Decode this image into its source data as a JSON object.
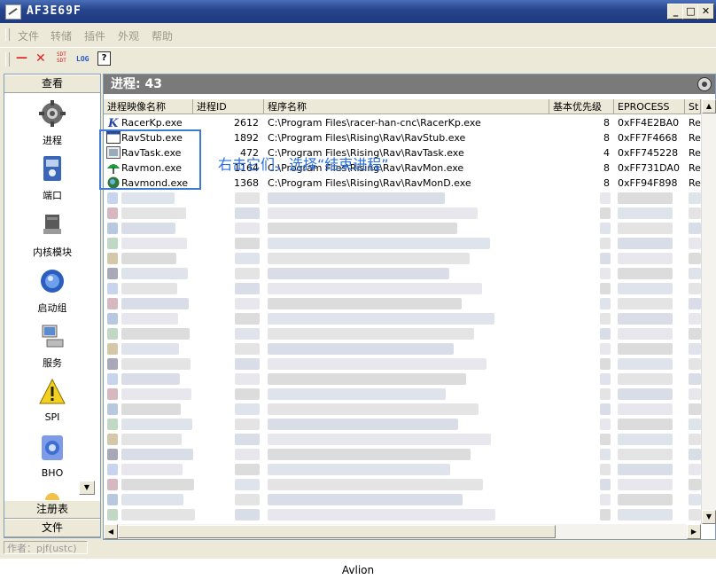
{
  "window": {
    "title": "AF3E69F",
    "min": "_",
    "max": "□",
    "close": "✕"
  },
  "menu": [
    "文件",
    "转储",
    "插件",
    "外观",
    "帮助"
  ],
  "toolbar": {
    "minimize_glyph": "—",
    "close_glyph": "✕",
    "sdt_top": "SDT",
    "sdt_bottom": "SDT",
    "log": "LOG",
    "help_glyph": "?"
  },
  "sidebar": {
    "header": "查看",
    "items": [
      "进程",
      "端口",
      "内核模块",
      "启动组",
      "服务",
      "SPI",
      "BHO"
    ],
    "footer": [
      "注册表",
      "文件"
    ],
    "scroll_glyph": "▼"
  },
  "main": {
    "header": "进程: 43",
    "columns": [
      "进程映像名称",
      "进程ID",
      "程序名称",
      "基本优先级",
      "EPROCESS",
      "St"
    ],
    "rows": [
      {
        "name": "RacerKp.exe",
        "pid": "2612",
        "path": "C:\\Program Files\\racer-han-cnc\\RacerKp.exe",
        "priority": "8",
        "eprocess": "0xFF4E2BA0",
        "state": "Re"
      },
      {
        "name": "RavStub.exe",
        "pid": "1892",
        "path": "C:\\Program Files\\Rising\\Rav\\RavStub.exe",
        "priority": "8",
        "eprocess": "0xFF7F4668",
        "state": "Re"
      },
      {
        "name": "RavTask.exe",
        "pid": "472",
        "path": "C:\\Program Files\\Rising\\Rav\\RavTask.exe",
        "priority": "4",
        "eprocess": "0xFF745228",
        "state": "Re"
      },
      {
        "name": "Ravmon.exe",
        "pid": "1164",
        "path": "C:\\Program Files\\Rising\\Rav\\RavMon.exe",
        "priority": "8",
        "eprocess": "0xFF731DA0",
        "state": "Re"
      },
      {
        "name": "Ravmond.exe",
        "pid": "1368",
        "path": "C:\\Program Files\\Rising\\Rav\\RavMonD.exe",
        "priority": "8",
        "eprocess": "0xFF94F898",
        "state": "Re"
      }
    ],
    "annotation": "右击它们，选择“结束进程”"
  },
  "status": {
    "author": "作者：pjf(ustc)"
  },
  "caption": "Avlion",
  "colors": {
    "title_bar": "#27468f",
    "callout": "#3b7bd6",
    "annotation_text": "#2a6fe0"
  }
}
